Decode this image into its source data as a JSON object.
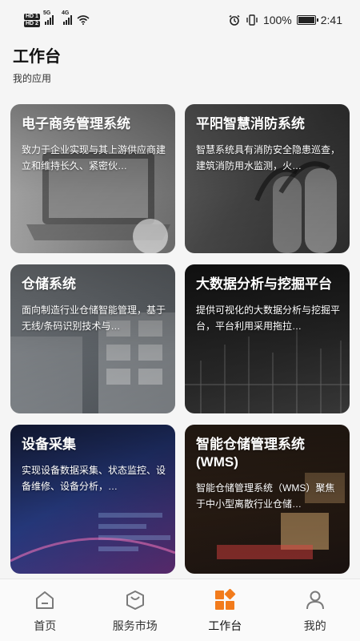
{
  "status_bar": {
    "hd1": "HD 1",
    "hd2": "HD 2",
    "net1": "5G",
    "net2": "4G",
    "battery": "100%",
    "time": "2:41"
  },
  "page": {
    "title": "工作台",
    "section_label": "我的应用"
  },
  "apps": [
    {
      "title": "电子商务管理系统",
      "desc": "致力于企业实现与其上游供应商建立和维持长久、紧密伙…"
    },
    {
      "title": "平阳智慧消防系统",
      "desc": "智慧系统具有消防安全隐患巡查，建筑消防用水监测，火…"
    },
    {
      "title": "仓储系统",
      "desc": "面向制造行业仓储智能管理，基于无线/条码识别技术与…"
    },
    {
      "title": "大数据分析与挖掘平台",
      "desc": "提供可视化的大数据分析与挖掘平台，平台利用采用拖拉…"
    },
    {
      "title": "设备采集",
      "desc": "实现设备数据采集、状态监控、设备维修、设备分析，…"
    },
    {
      "title": "智能仓储管理系统(WMS)",
      "desc": "智能仓储管理系统（WMS）聚焦于中小型离散行业仓储…"
    }
  ],
  "bottom_nav": {
    "items": [
      {
        "label": "首页",
        "icon": "home-icon"
      },
      {
        "label": "服务市场",
        "icon": "shopping-bag-icon"
      },
      {
        "label": "工作台",
        "icon": "workbench-grid-icon"
      },
      {
        "label": "我的",
        "icon": "user-icon"
      }
    ],
    "active_color": "#f27b1c",
    "inactive_color": "#7a7a7a"
  }
}
